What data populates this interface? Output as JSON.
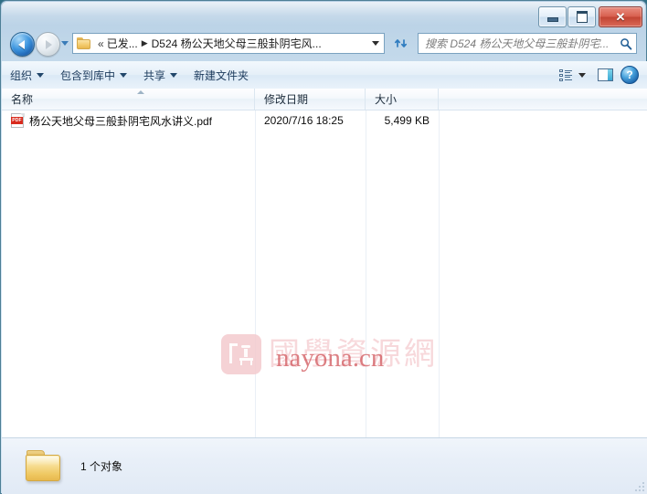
{
  "window": {
    "title": "",
    "controls": {
      "minimize": "—",
      "maximize": "□",
      "close": "✕"
    }
  },
  "navigation": {
    "back_icon": "back-arrow-icon",
    "forward_icon": "forward-arrow-icon",
    "history_icon": "recent-pages-dropdown",
    "refresh_icon": "refresh-icon"
  },
  "address": {
    "folder_icon": "folder-icon",
    "overflow": "«",
    "crumb1": "已发...",
    "separator": "▶",
    "crumb2": "D524 杨公天地父母三般卦阴宅风...",
    "dropdown_icon": "chevron-down-icon"
  },
  "search": {
    "placeholder": "搜索 D524 杨公天地父母三般卦阴宅...",
    "value": "",
    "icon": "search-icon"
  },
  "toolbar": {
    "organize": "组织",
    "include_in_library": "包含到库中",
    "share": "共享",
    "new_folder": "新建文件夹",
    "view_icon": "view-layout-icon",
    "preview_icon": "preview-pane-icon",
    "help_icon": "help-icon"
  },
  "columns": [
    {
      "label": "名称",
      "sorted": "asc"
    },
    {
      "label": "修改日期",
      "sorted": ""
    },
    {
      "label": "大小",
      "sorted": ""
    }
  ],
  "files": [
    {
      "icon": "pdf-file-icon",
      "icon_label": "PDF",
      "name": "杨公天地父母三般卦阴宅风水讲义.pdf",
      "modified": "2020/7/16 18:25",
      "size": "5,499 KB"
    }
  ],
  "watermark": {
    "logo": "guoxue-logo",
    "chinese": "國學資源網",
    "latin": "nayona.cn",
    "chinese_color": "#f7d8db",
    "latin_color": "#d35d62"
  },
  "statusbar": {
    "folder_icon": "folder-icon",
    "item_count": "1 个对象"
  },
  "colors": {
    "frame": "#b6cfe4",
    "accent": "#3f97e0",
    "close_button": "#c24433",
    "pdf_red": "#d82b1e",
    "folder_yellow": "#efc862"
  }
}
